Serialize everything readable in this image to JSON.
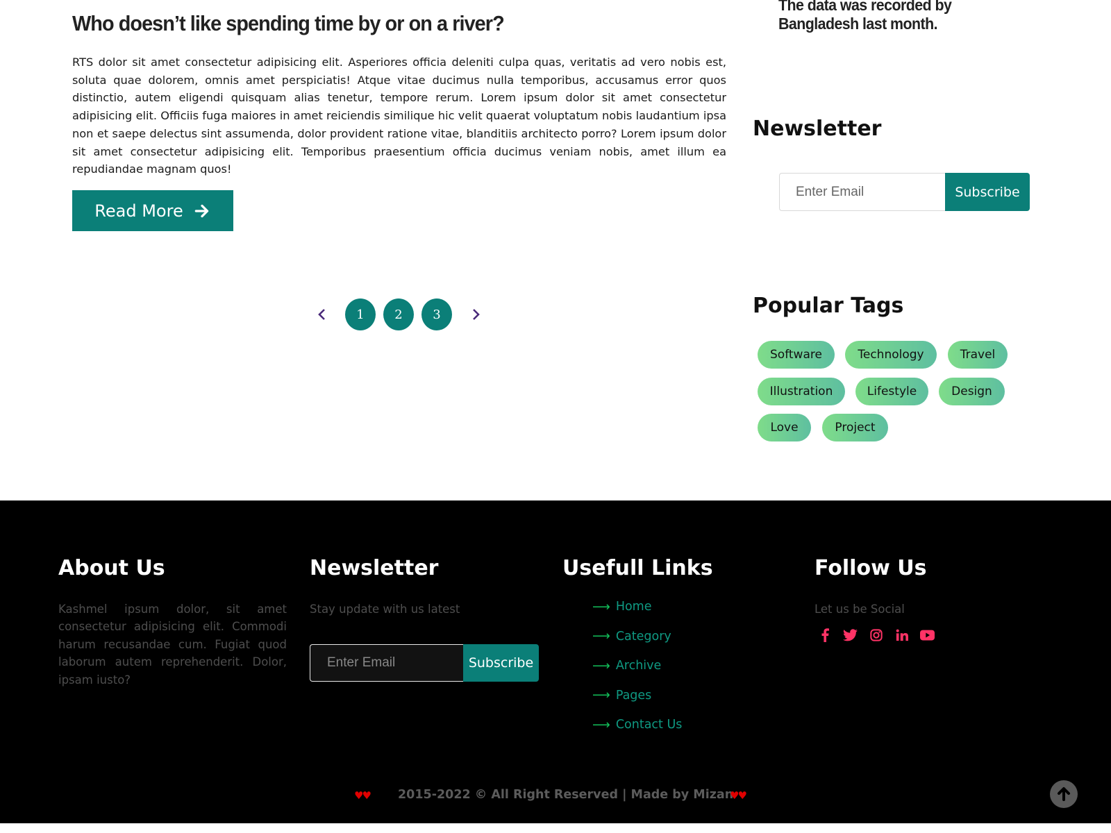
{
  "post": {
    "title": "Who doesn’t like spending time by or on a river?",
    "body": "RTS dolor sit amet consectetur adipisicing elit. Asperiores officia deleniti culpa quas, veritatis ad vero nobis est, soluta quae dolorem, omnis amet perspiciatis! Atque vitae ducimus nulla temporibus, accusamus error quos distinctio, autem eligendi quisquam alias tenetur, tempore rerum. Lorem ipsum dolor sit amet consectetur adipisicing elit. Officiis fuga maiores in amet reiciendis similique hic velit quaerat voluptatum nobis laudantium ipsa non et saepe delectus sint assumenda, dolor provident ratione vitae, blanditiis architecto porro? Lorem ipsum dolor sit amet consectetur adipisicing elit. Temporibus praesentium officia ducimus veniam nobis, amet illum ea repudiandae magnam quos!",
    "read_more_label": "Read More"
  },
  "pagination": {
    "pages": [
      "1",
      "2",
      "3"
    ],
    "prev_icon": "chevron-left-icon",
    "next_icon": "chevron-right-icon"
  },
  "sidebar": {
    "data_note": "The data was recorded by Bangladesh last month.",
    "newsletter_heading": "Newsletter",
    "email_placeholder": "Enter Email",
    "subscribe_label": "Subscribe",
    "tags_heading": "Popular Tags",
    "tags": [
      "Software",
      "Technology",
      "Travel",
      "Illustration",
      "Lifestyle",
      "Design",
      "Love",
      "Project"
    ]
  },
  "footer": {
    "about_heading": "About Us",
    "about_text": "Kashmel ipsum dolor, sit amet consectetur adipisicing elit. Commodi harum recusandae cum. Fugiat quod laborum autem reprehenderit. Dolor, ipsam iusto?",
    "newsletter_heading": "Newsletter",
    "newsletter_text": "Stay update with us latest",
    "email_placeholder": "Enter Email",
    "subscribe_label": "Subscribe",
    "links_heading": "Usefull Links",
    "links": [
      "Home",
      "Category",
      "Archive",
      "Pages",
      "Contact Us"
    ],
    "follow_heading": "Follow Us",
    "follow_text": "Let us be Social",
    "social_icons": [
      "facebook-icon",
      "twitter-icon",
      "instagram-icon",
      "linkedin-icon",
      "youtube-icon"
    ],
    "hearts": "♥♥",
    "copyright": "2015-2022 © All Right Reserved | Made by Mizan"
  },
  "colors": {
    "accent": "#0b7f78",
    "tag_gradient_start": "#7fdc8a",
    "tag_gradient_end": "#5ebfa0",
    "social_icon": "#ff3366",
    "link": "#0f9a83",
    "link_arrow": "#12c05a",
    "footer_bg": "#000000",
    "pager_arrow": "#4a2a7a",
    "heart": "#e00000"
  },
  "scroll_top_icon": "arrow-up-circle-icon"
}
